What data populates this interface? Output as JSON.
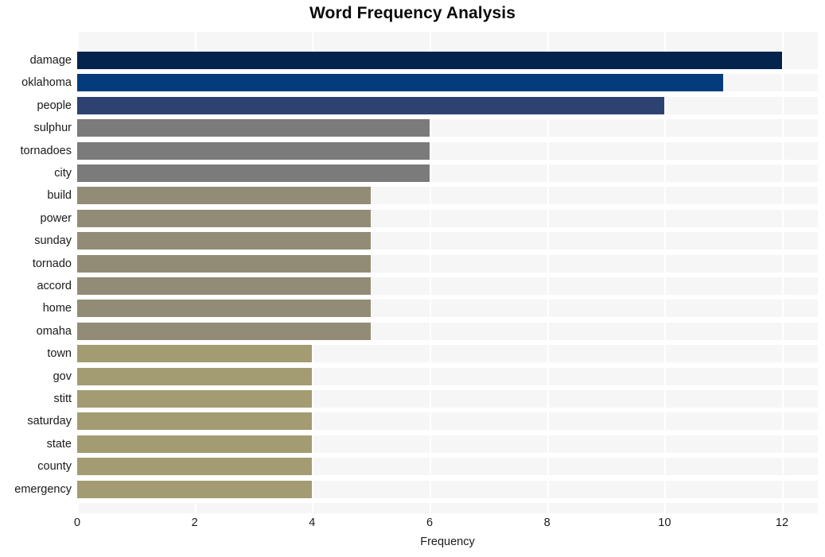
{
  "chart_data": {
    "type": "bar",
    "orientation": "horizontal",
    "title": "Word Frequency Analysis",
    "xlabel": "Frequency",
    "ylabel": "",
    "xlim": [
      0,
      12
    ],
    "xticks": [
      0,
      2,
      4,
      6,
      8,
      10,
      12
    ],
    "xtick_labels": [
      "0",
      "2",
      "4",
      "6",
      "8",
      "10",
      "12"
    ],
    "grid": true,
    "grid_axis": "x",
    "legend": false,
    "plot_background": "#f6f6f7",
    "page_background": "#ffffff",
    "categories": [
      "damage",
      "oklahoma",
      "people",
      "sulphur",
      "tornadoes",
      "city",
      "build",
      "power",
      "sunday",
      "tornado",
      "accord",
      "home",
      "omaha",
      "town",
      "gov",
      "stitt",
      "saturday",
      "state",
      "county",
      "emergency"
    ],
    "values": [
      12,
      11,
      10,
      6,
      6,
      6,
      5,
      5,
      5,
      5,
      5,
      5,
      5,
      4,
      4,
      4,
      4,
      4,
      4,
      4
    ],
    "bar_colors": [
      "#04234d",
      "#033b7d",
      "#2e4272",
      "#7b7b7b",
      "#7b7b7b",
      "#7b7b7b",
      "#928c76",
      "#928c76",
      "#928c76",
      "#928c76",
      "#928c76",
      "#928c76",
      "#928c76",
      "#a39c72",
      "#a39c72",
      "#a39c72",
      "#a39c72",
      "#a39c72",
      "#a39c72",
      "#a39c72"
    ]
  }
}
